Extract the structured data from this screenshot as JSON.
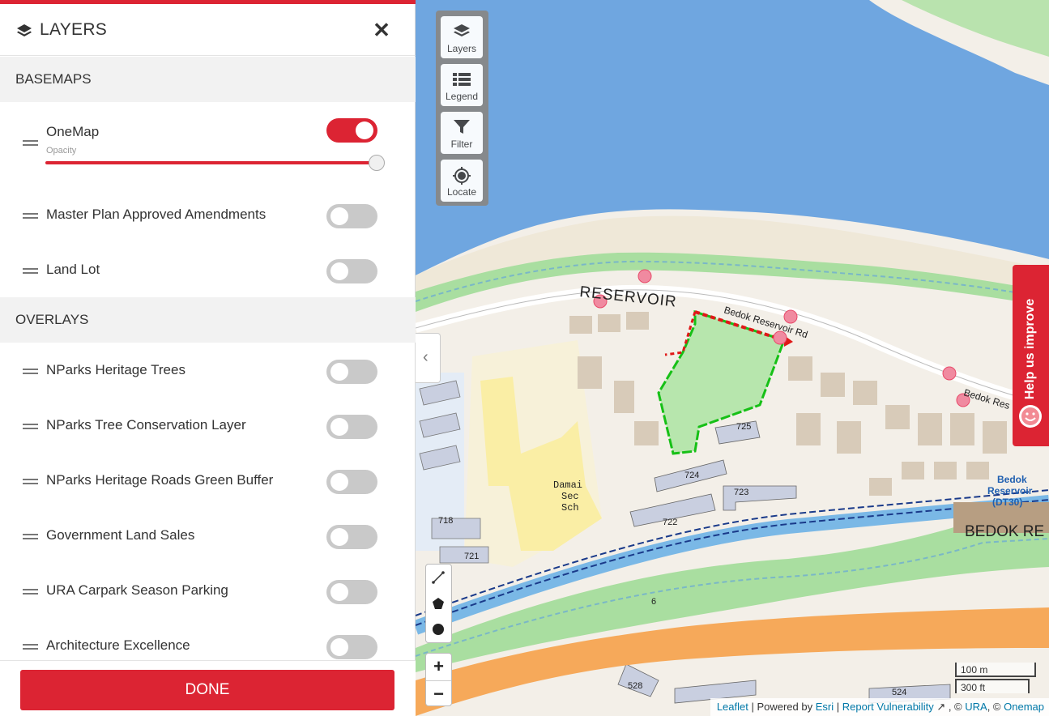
{
  "panel": {
    "title": "LAYERS",
    "close_symbol": "✕",
    "basemaps_heading": "BASEMAPS",
    "basemaps": [
      {
        "label": "OneMap",
        "enabled": true,
        "opacity_label": "Opacity",
        "opacity": 1.0
      },
      {
        "label": "Master Plan Approved Amendments",
        "enabled": false
      },
      {
        "label": "Land Lot",
        "enabled": false
      }
    ],
    "overlays_heading": "OVERLAYS",
    "overlays": [
      {
        "label": "NParks Heritage Trees",
        "enabled": false
      },
      {
        "label": "NParks Tree Conservation Layer",
        "enabled": false
      },
      {
        "label": "NParks Heritage Roads Green Buffer",
        "enabled": false
      },
      {
        "label": "Government Land Sales",
        "enabled": false
      },
      {
        "label": "URA Carpark Season Parking",
        "enabled": false
      },
      {
        "label": "Architecture Excellence",
        "enabled": false
      }
    ],
    "done_label": "DONE"
  },
  "map": {
    "toolbar": {
      "layers": "Layers",
      "legend": "Legend",
      "filter": "Filter",
      "locate": "Locate"
    },
    "collapse_symbol": "‹",
    "zoom_in": "+",
    "zoom_out": "−",
    "help_label": "Help us improve",
    "scale_metric": "100 m",
    "scale_imperial": "300 ft",
    "labels": {
      "reservoir": "RESERVOIR",
      "road": "Bedok Reservoir Rd",
      "road2": "Bedok Res",
      "school1": "Damai",
      "school2": "Sec",
      "school3": "Sch",
      "station1": "Bedok",
      "station2": "Reservoir",
      "station3": "(DT30)",
      "station_sign": "BEDOK RE",
      "blk725": "725",
      "blk724": "724",
      "blk723": "723",
      "blk722": "722",
      "blk718": "718",
      "blk721": "721",
      "blk528": "528",
      "blk524": "524",
      "road_no": "6"
    },
    "attribution": {
      "leaflet": "Leaflet",
      "sep1": " | Powered by ",
      "esri": "Esri",
      "sep2": " | ",
      "report": "Report Vulnerability",
      "sep3": " , © ",
      "ura": "URA",
      "sep4": ", © ",
      "onemap": "Onemap"
    },
    "colors": {
      "water": "#6fa6e0",
      "park": "#a9dea0",
      "expressway": "#f6a95a",
      "highlight": "#00c000",
      "accent": "#dc2433"
    }
  }
}
